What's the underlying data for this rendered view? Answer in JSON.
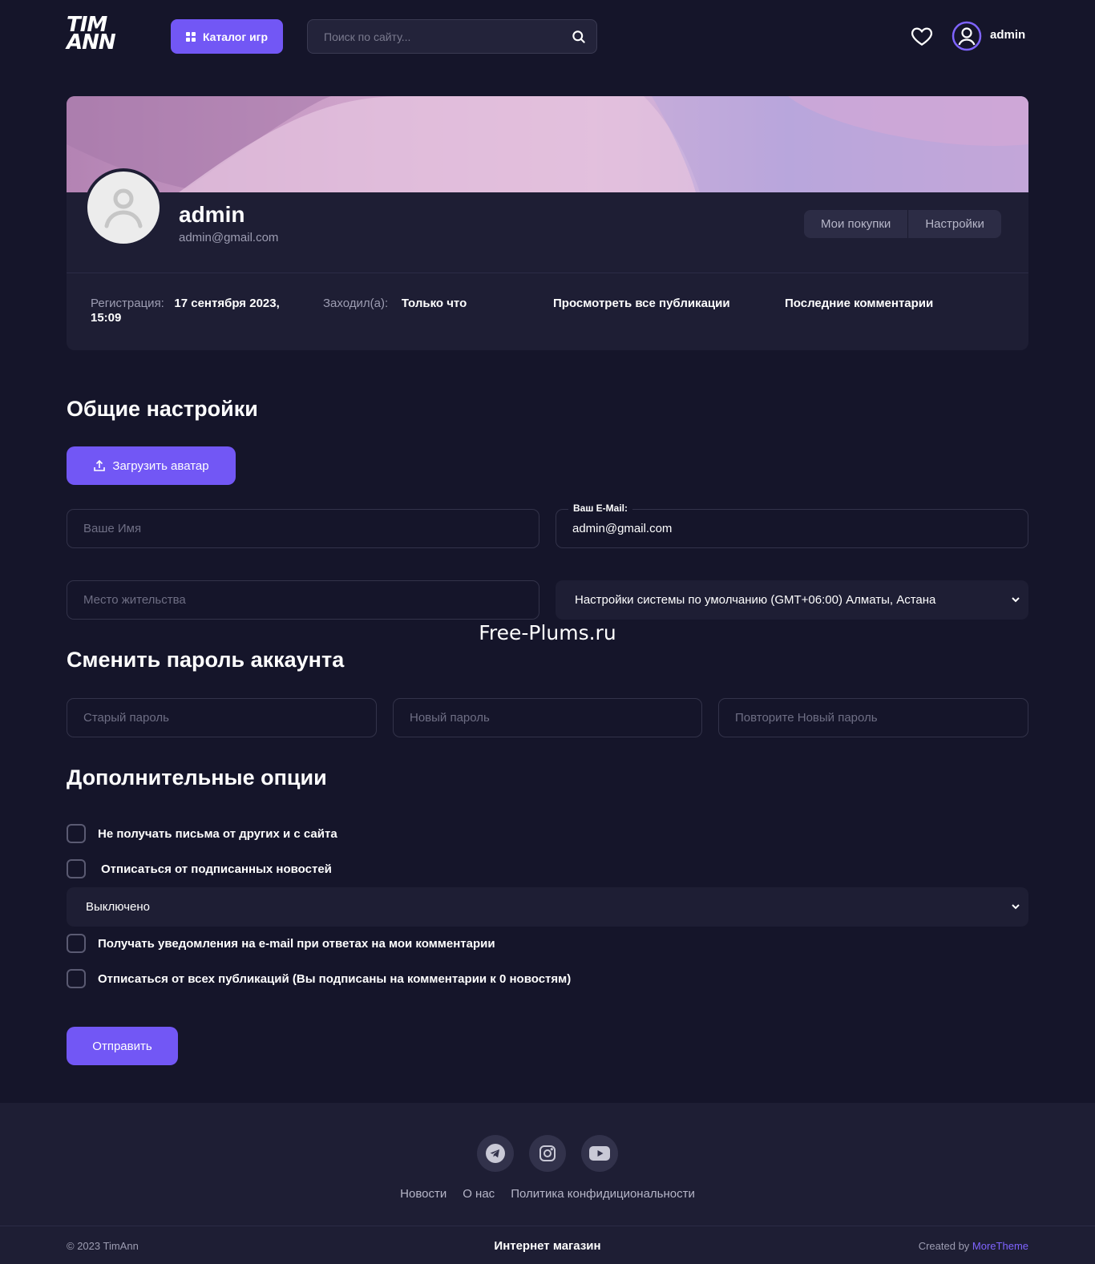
{
  "header": {
    "logo_line1": "TIM",
    "logo_line2": "ANN",
    "catalog_label": "Каталог игр",
    "search_placeholder": "Поиск по сайту...",
    "username": "admin"
  },
  "profile": {
    "name": "admin",
    "email": "admin@gmail.com",
    "tabs": [
      "Мои покупки",
      "Настройки"
    ],
    "registration_label": "Регистрация:",
    "registration_value": "17 сентября 2023, 15:09",
    "visited_label": "Заходил(а):",
    "visited_value": "Только что",
    "link_publications": "Просмотреть все публикации",
    "link_comments": "Последние комментарии"
  },
  "settings": {
    "title": "Общие настройки",
    "upload_avatar": "Загрузить аватар",
    "name_placeholder": "Ваше Имя",
    "email_label": "Ваш E-Mail:",
    "email_value": "admin@gmail.com",
    "city_placeholder": "Место жительства",
    "timezone_value": "Настройки системы по умолчанию (GMT+06:00) Алматы, Астана"
  },
  "watermark": "Free-Plums.ru",
  "password": {
    "title": "Сменить пароль аккаунта",
    "old_placeholder": "Старый пароль",
    "new_placeholder": "Новый пароль",
    "repeat_placeholder": "Повторите Новый пароль"
  },
  "options": {
    "title": "Дополнительные опции",
    "opt1": "Не получать письма от других и с сайта",
    "opt2": "Отписаться от подписанных новостей",
    "select_value": "Выключено",
    "opt3": "Получать уведомления на e-mail при ответах на мои комментарии",
    "opt4": "Отписаться от всех публикаций (Вы подписаны на комментарии к 0 новостям)",
    "submit": "Отправить"
  },
  "footer": {
    "socials": [
      "telegram-icon",
      "instagram-icon",
      "youtube-icon"
    ],
    "links": [
      "Новости",
      "О нас",
      "Политика конфидициональности"
    ],
    "copyright": "© 2023 TimAnn",
    "center": "Интернет магазин",
    "created_by": "Created by",
    "created_link": "MoreTheme"
  },
  "colors": {
    "accent": "#7257f5",
    "background": "#15152a",
    "panel": "#1e1e34"
  }
}
